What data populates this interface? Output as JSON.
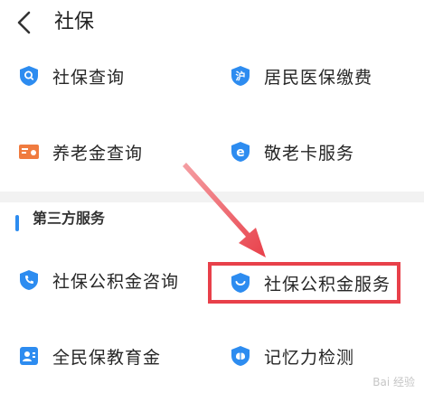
{
  "header": {
    "title": "社保"
  },
  "social_security": {
    "items": [
      {
        "label": "社保查询",
        "icon": "shield-search-icon"
      },
      {
        "label": "居民医保缴费",
        "icon": "shield-hu-icon"
      },
      {
        "label": "养老金查询",
        "icon": "id-card-icon"
      },
      {
        "label": "敬老卡服务",
        "icon": "shield-e-icon"
      }
    ]
  },
  "third_party": {
    "title": "第三方服务",
    "items": [
      {
        "label": "社保公积金咨询",
        "icon": "shield-phone-icon"
      },
      {
        "label": "社保公积金服务",
        "icon": "shield-smile-icon"
      },
      {
        "label": "全民保教育金",
        "icon": "person-card-icon"
      },
      {
        "label": "记忆力检测",
        "icon": "brain-icon"
      }
    ]
  },
  "colors": {
    "accent": "#2d8cf0",
    "highlight": "#e8404a",
    "id_card": "#f07b3f"
  }
}
